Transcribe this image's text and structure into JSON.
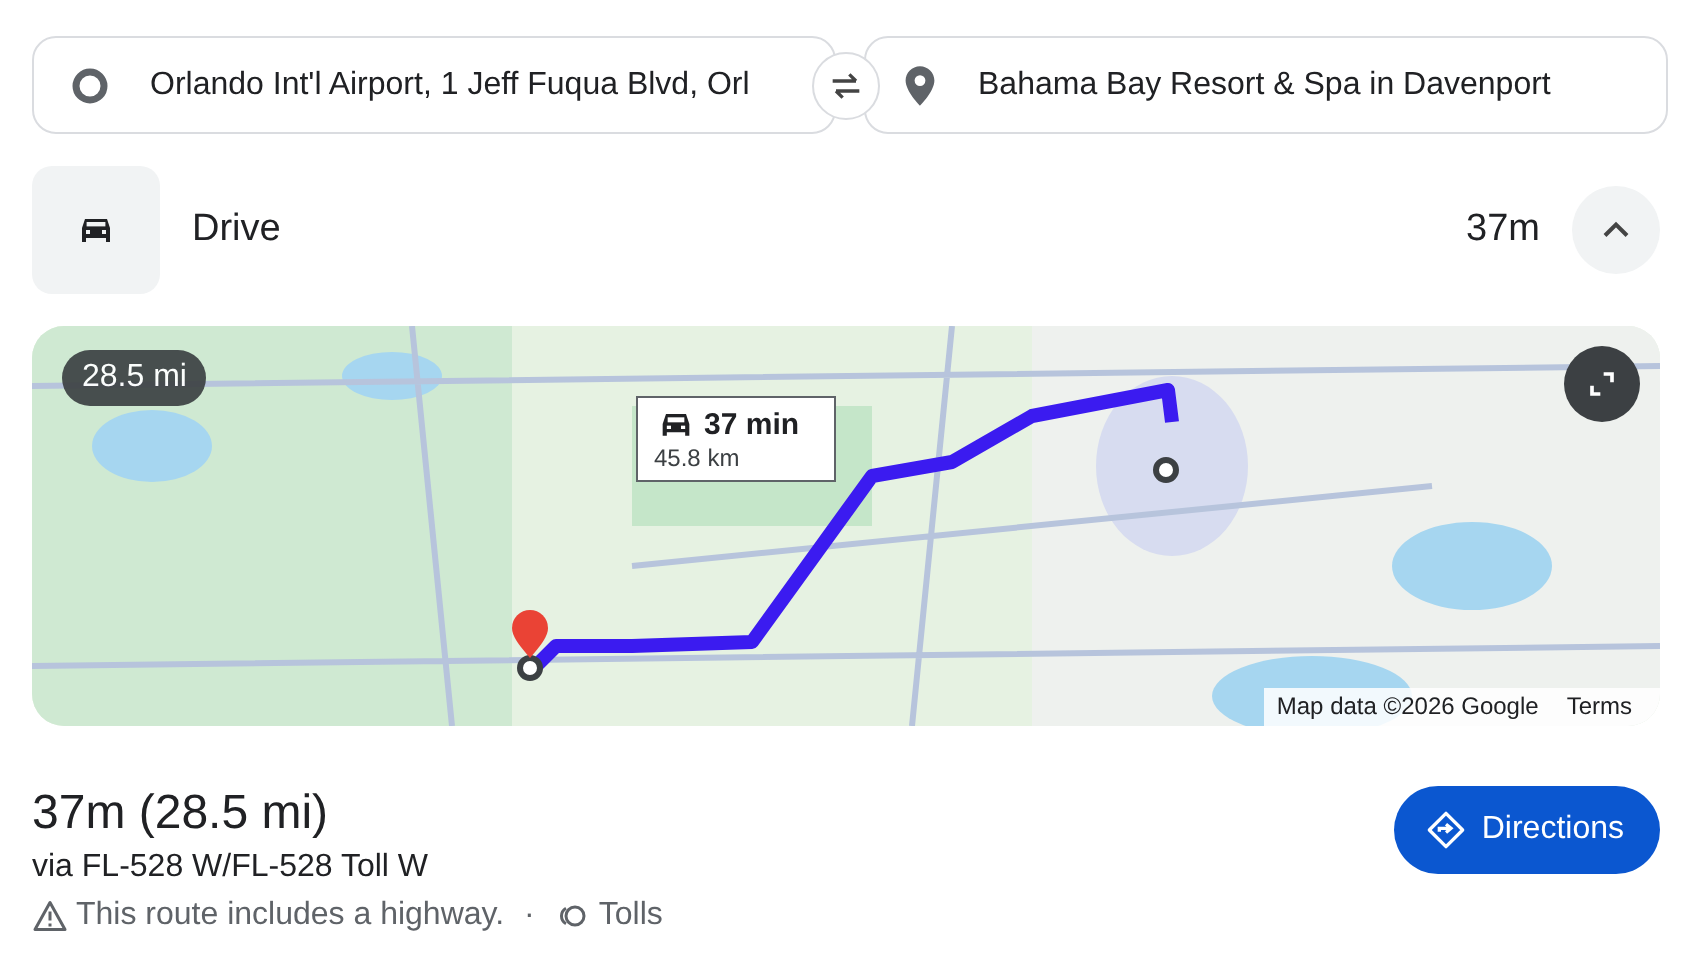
{
  "route_inputs": {
    "origin": {
      "value": "Orlando Int'l Airport, 1 Jeff Fuqua Blvd, Orl"
    },
    "destination": {
      "value": "Bahama Bay Resort & Spa in Davenport"
    }
  },
  "mode": {
    "label": "Drive",
    "duration": "37m",
    "expanded": true
  },
  "map": {
    "distance_badge": "28.5 mi",
    "callout": {
      "duration": "37 min",
      "distance": "45.8 km"
    },
    "attribution": "Map data ©2026 Google",
    "terms": "Terms"
  },
  "summary": {
    "title": "37m (28.5 mi)",
    "via": "via FL-528 W/FL-528 Toll W",
    "notes": [
      {
        "kind": "warning",
        "text": "This route includes a highway."
      },
      {
        "kind": "separator",
        "text": "·"
      },
      {
        "kind": "tolls",
        "text": "Tolls"
      }
    ]
  },
  "directions_button": "Directions"
}
